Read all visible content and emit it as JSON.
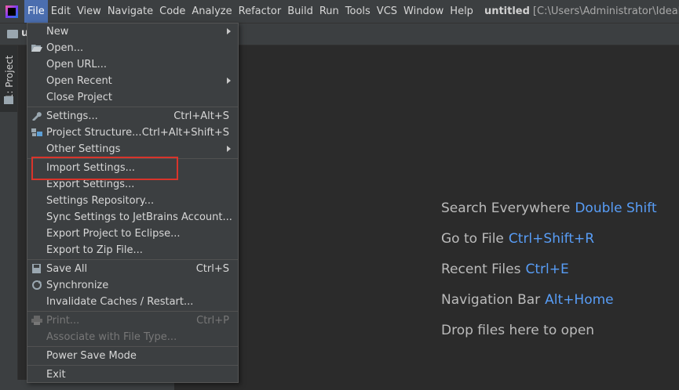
{
  "menubar": {
    "items": [
      "File",
      "Edit",
      "View",
      "Navigate",
      "Code",
      "Analyze",
      "Refactor",
      "Build",
      "Run",
      "Tools",
      "VCS",
      "Window",
      "Help"
    ],
    "project_name": "untitled",
    "project_path": "[C:\\Users\\Administrator\\IdeaPro"
  },
  "navbar": {
    "crumb": "u"
  },
  "toolwindow": {
    "project_tab": "1: Project"
  },
  "file_menu": {
    "new": "New",
    "open": "Open...",
    "open_url": "Open URL...",
    "open_recent": "Open Recent",
    "close_project": "Close Project",
    "settings": "Settings...",
    "settings_shortcut": "Ctrl+Alt+S",
    "project_structure": "Project Structure...",
    "project_structure_shortcut": "Ctrl+Alt+Shift+S",
    "other_settings": "Other Settings",
    "import_settings": "Import Settings...",
    "export_settings": "Export Settings...",
    "settings_repository": "Settings Repository...",
    "sync_settings": "Sync Settings to JetBrains Account...",
    "export_eclipse": "Export Project to Eclipse...",
    "export_zip": "Export to Zip File...",
    "save_all": "Save All",
    "save_all_shortcut": "Ctrl+S",
    "synchronize": "Synchronize",
    "invalidate_caches": "Invalidate Caches / Restart...",
    "print": "Print...",
    "print_shortcut": "Ctrl+P",
    "associate_file_type": "Associate with File Type...",
    "power_save": "Power Save Mode",
    "exit": "Exit"
  },
  "welcome": {
    "hints": [
      {
        "label": "Search Everywhere",
        "key": "Double Shift"
      },
      {
        "label": "Go to File",
        "key": "Ctrl+Shift+R"
      },
      {
        "label": "Recent Files",
        "key": "Ctrl+E"
      },
      {
        "label": "Navigation Bar",
        "key": "Alt+Home"
      },
      {
        "label": "Drop files here to open",
        "key": ""
      }
    ]
  },
  "colors": {
    "accent_active_menu": "#4b6eaf",
    "shortcut_key": "#589df6",
    "highlight_box": "#d9342b"
  },
  "icons": [
    "app-logo-icon",
    "folder-icon",
    "open-folder-icon",
    "wrench-icon",
    "project-structure-icon",
    "save-icon",
    "sync-icon",
    "print-icon",
    "submenu-arrow-icon"
  ]
}
